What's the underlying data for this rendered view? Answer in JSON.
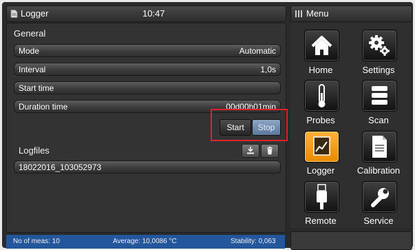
{
  "window": {
    "title": "Logger",
    "time": "10:47"
  },
  "general": {
    "heading": "General",
    "fields": [
      {
        "label": "Mode",
        "value": "Automatic"
      },
      {
        "label": "Interval",
        "value": "1,0s"
      },
      {
        "label": "Start time",
        "value": ""
      },
      {
        "label": "Duration time",
        "value": "00d00h01min"
      }
    ],
    "start_label": "Start",
    "stop_label": "Stop"
  },
  "logfiles": {
    "heading": "Logfiles",
    "items": [
      "18022016_103052973"
    ],
    "export_icon": "download-icon",
    "delete_icon": "trash-icon"
  },
  "status": {
    "meas": "No of meas: 10",
    "average": "Average: 10,0086 °C",
    "stability": "Stability: 0,063"
  },
  "menu": {
    "title": "Menu",
    "items": [
      {
        "label": "Home",
        "icon": "house-icon"
      },
      {
        "label": "Settings",
        "icon": "gears-icon"
      },
      {
        "label": "Probes",
        "icon": "thermometer-icon"
      },
      {
        "label": "Scan",
        "icon": "stack-icon"
      },
      {
        "label": "Logger",
        "icon": "logger-chart-icon",
        "active": true
      },
      {
        "label": "Calibration",
        "icon": "calibration-document-icon"
      },
      {
        "label": "Remote",
        "icon": "usb-plug-icon"
      },
      {
        "label": "Service",
        "icon": "wrench-icon"
      }
    ]
  },
  "colors": {
    "accent": "#f39a12",
    "statusbar": "#23569a",
    "highlight": "#e0202a",
    "stop_button": "#6f8aab"
  }
}
